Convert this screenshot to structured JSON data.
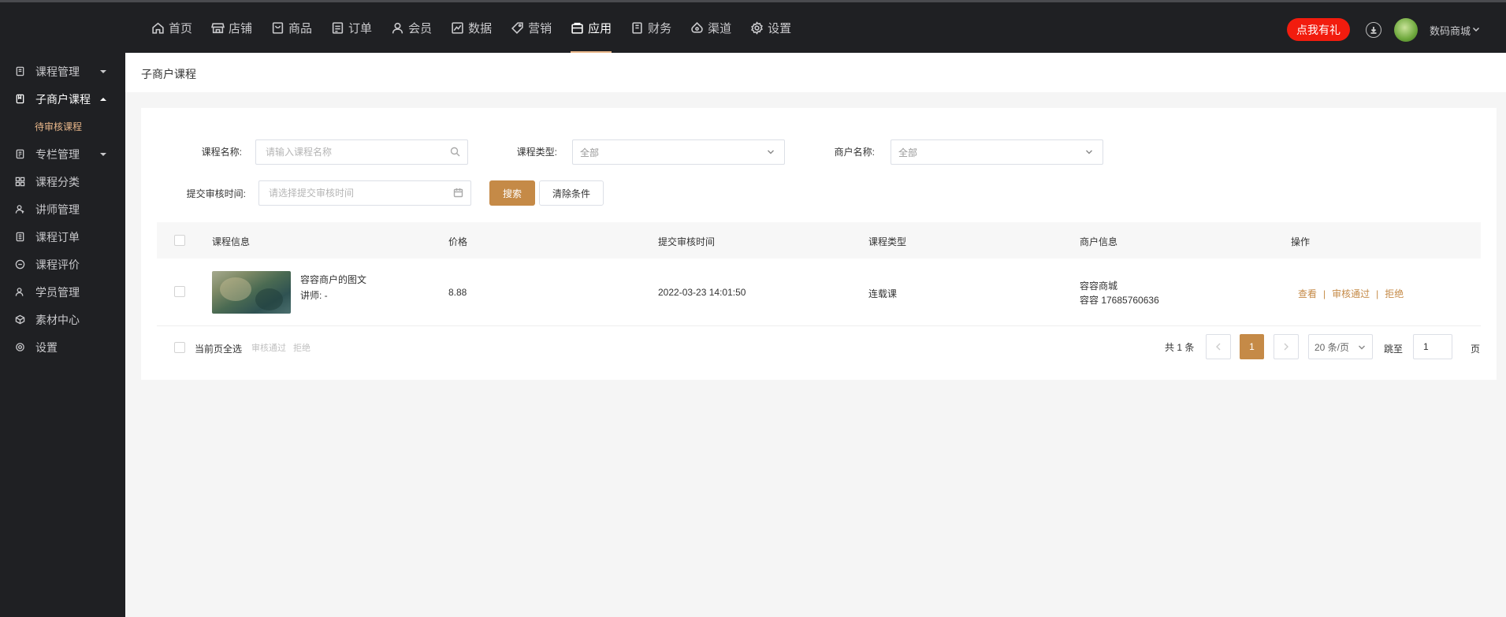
{
  "topnav": [
    {
      "label": "首页",
      "icon": "home-icon"
    },
    {
      "label": "店铺",
      "icon": "store-icon"
    },
    {
      "label": "商品",
      "icon": "product-icon"
    },
    {
      "label": "订单",
      "icon": "order-icon"
    },
    {
      "label": "会员",
      "icon": "member-icon"
    },
    {
      "label": "数据",
      "icon": "chart-icon"
    },
    {
      "label": "营销",
      "icon": "tag-icon"
    },
    {
      "label": "应用",
      "icon": "app-icon",
      "active": true
    },
    {
      "label": "财务",
      "icon": "finance-icon"
    },
    {
      "label": "渠道",
      "icon": "channel-icon"
    },
    {
      "label": "设置",
      "icon": "gear-icon"
    }
  ],
  "header": {
    "gift_label": "点我有礼",
    "user_name": "数码商城"
  },
  "sidebar": {
    "items": [
      {
        "label": "课程管理"
      },
      {
        "label": "子商户课程"
      },
      {
        "label": "待审核课程"
      },
      {
        "label": "专栏管理"
      },
      {
        "label": "课程分类"
      },
      {
        "label": "讲师管理"
      },
      {
        "label": "课程订单"
      },
      {
        "label": "课程评价"
      },
      {
        "label": "学员管理"
      },
      {
        "label": "素材中心"
      },
      {
        "label": "设置"
      }
    ]
  },
  "page": {
    "title": "子商户课程"
  },
  "filters": {
    "course_name_label": "课程名称:",
    "course_name_placeholder": "请输入课程名称",
    "course_type_label": "课程类型:",
    "course_type_value": "全部",
    "merchant_label": "商户名称:",
    "merchant_value": "全部",
    "submit_time_label": "提交审核时间:",
    "submit_time_placeholder": "请选择提交审核时间",
    "search_label": "搜索",
    "clear_label": "清除条件"
  },
  "table": {
    "columns": [
      "课程信息",
      "价格",
      "提交审核时间",
      "课程类型",
      "商户信息",
      "操作"
    ],
    "rows": [
      {
        "title": "容容商户的图文",
        "teacher": "讲师: -",
        "price": "8.88",
        "submit_time": "2022-03-23 14:01:50",
        "type": "连载课",
        "merchant_name": "容容商城",
        "merchant_contact": "容容 17685760636",
        "actions": [
          "查看",
          "审核通过",
          "拒绝"
        ]
      }
    ]
  },
  "footer": {
    "select_all_label": "当前页全选",
    "batch_approve": "审核通过",
    "batch_reject": "拒绝"
  },
  "pagination": {
    "total_text": "共 1 条",
    "current_page": "1",
    "page_size": "20 条/页",
    "jump_label": "跳至",
    "jump_value": "1",
    "page_suffix": "页"
  },
  "colors": {
    "accent": "#c58a47",
    "gift": "#f21c0e",
    "dark": "#1f2023"
  }
}
